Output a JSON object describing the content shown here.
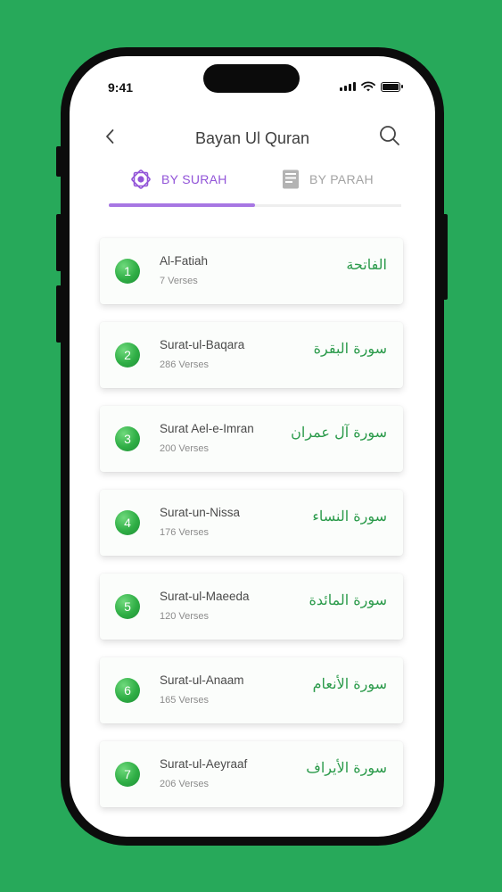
{
  "status_bar": {
    "time": "9:41"
  },
  "header": {
    "title": "Bayan Ul Quran"
  },
  "tabs": [
    {
      "label": "BY SURAH",
      "active": true,
      "icon": "star-icon"
    },
    {
      "label": "BY PARAH",
      "active": false,
      "icon": "book-icon"
    }
  ],
  "surahs": [
    {
      "number": "1",
      "name": "Al-Fatiah",
      "verses": "7 Verses",
      "arabic": "الفاتحة"
    },
    {
      "number": "2",
      "name": "Surat-ul-Baqara",
      "verses": "286 Verses",
      "arabic": "سورة البقرة"
    },
    {
      "number": "3",
      "name": "Surat Ael-e-Imran",
      "verses": "200 Verses",
      "arabic": "سورة آل عمران"
    },
    {
      "number": "4",
      "name": "Surat-un-Nissa",
      "verses": "176 Verses",
      "arabic": "سورة النساء"
    },
    {
      "number": "5",
      "name": "Surat-ul-Maeeda",
      "verses": "120 Verses",
      "arabic": "سورة المائدة"
    },
    {
      "number": "6",
      "name": "Surat-ul-Anaam",
      "verses": "165 Verses",
      "arabic": "سورة الأنعام"
    },
    {
      "number": "7",
      "name": "Surat-ul-Aeyraaf",
      "verses": "206 Verses",
      "arabic": "سورة الأيراف"
    }
  ],
  "colors": {
    "background": "#27a95a",
    "accent_purple": "#9254d8",
    "badge_green": "#2fae45",
    "arabic_green": "#2a9a4a"
  }
}
